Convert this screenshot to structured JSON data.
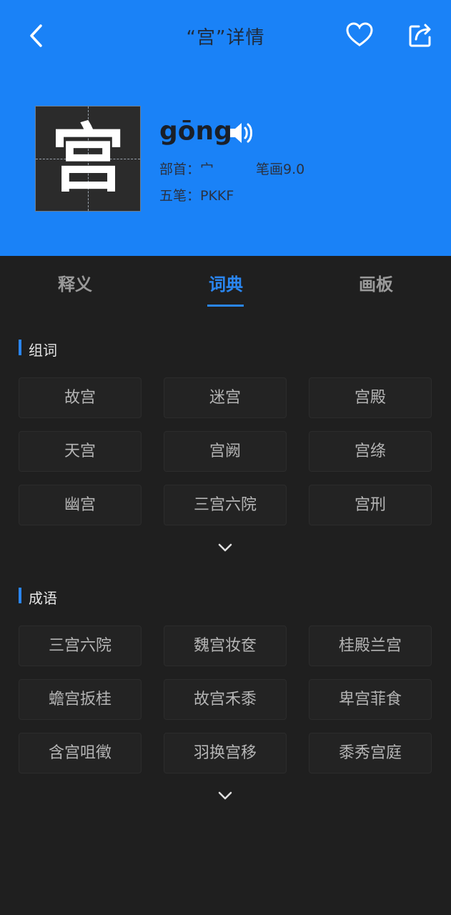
{
  "nav": {
    "title": "“宫”详情"
  },
  "character": {
    "glyph": "宫",
    "pinyin": "gōng",
    "radical": "部首：宀",
    "strokes": "笔画9.0",
    "wubi": "五笔：PKKF"
  },
  "tabs": [
    {
      "label": "释义",
      "active": false
    },
    {
      "label": "词典",
      "active": true
    },
    {
      "label": "画板",
      "active": false
    }
  ],
  "words": {
    "title": "组词",
    "items": [
      "故宫",
      "迷宫",
      "宫殿",
      "天宫",
      "宫阙",
      "宫绦",
      "幽宫",
      "三宫六院",
      "宫刑"
    ]
  },
  "idioms": {
    "title": "成语",
    "items": [
      "三宫六院",
      "魏宫妆奁",
      "桂殿兰宫",
      "蟾宫扳桂",
      "故宫禾黍",
      "卑宫菲食",
      "含宫咀徵",
      "羽换宫移",
      "黍秀宫庭"
    ]
  },
  "colors": {
    "accent": "#2a86f0",
    "header": "#1a82f7",
    "background": "#1f1f1f"
  }
}
